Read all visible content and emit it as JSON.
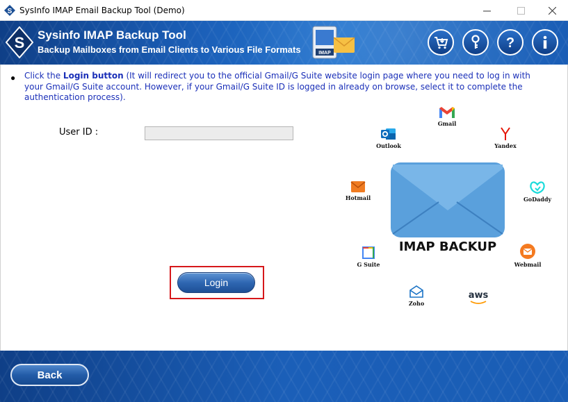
{
  "window": {
    "title": "SysInfo IMAP Email Backup Tool (Demo)",
    "minimize_symbol": "—",
    "maximize_symbol": "☐",
    "close_symbol": "✕"
  },
  "header": {
    "title": "Sysinfo IMAP Backup Tool",
    "subtitle": "Backup Mailboxes from Email Clients to Various File Formats",
    "imap_badge": "IMAP",
    "icons": [
      "cart-icon",
      "key-icon",
      "help-icon",
      "info-icon"
    ]
  },
  "instruction": {
    "bullet": "●",
    "prefix": "Click the ",
    "bold": "Login button",
    "suffix": " (It will redirect you to the official Gmail/G Suite website login page where you need to log in with your Gmail/G Suite account. However, if your Gmail/G Suite ID is logged in already on browse, select it to complete the authentication process)."
  },
  "form": {
    "user_id_label": "User ID  :",
    "user_id_value": ""
  },
  "buttons": {
    "login": "Login",
    "back": "Back"
  },
  "graphic": {
    "center_label": "IMAP BACKUP",
    "services": {
      "gmail": "Gmail",
      "outlook": "Outlook",
      "yandex": "Yandex",
      "hotmail": "Hotmail",
      "godaddy": "GoDaddy",
      "gsuite": "G Suite",
      "webmail": "Webmail",
      "zoho": "Zoho",
      "aws": "aws"
    }
  },
  "colors": {
    "brand_blue": "#1b5fb8",
    "instruction_text": "#1a2fb8",
    "highlight_red": "#d6171a"
  }
}
